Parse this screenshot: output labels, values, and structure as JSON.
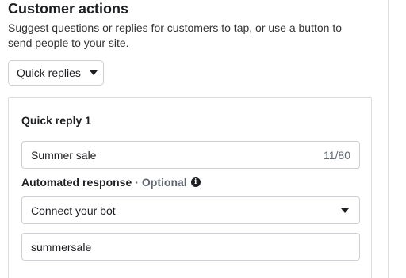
{
  "section": {
    "title": "Customer actions",
    "description": "Suggest questions or replies for customers to tap, or use a button to send people to your site."
  },
  "action_type": {
    "selected": "Quick replies",
    "icon": "caret-down-icon"
  },
  "quick_reply": {
    "title": "Quick reply 1",
    "text_value": "Summer sale",
    "char_count": "11/80"
  },
  "automated_response": {
    "label": "Automated response",
    "separator": "·",
    "optional": "Optional",
    "info_icon_glyph": "i",
    "selected": "Connect your bot",
    "keyword_value": "summersale"
  }
}
